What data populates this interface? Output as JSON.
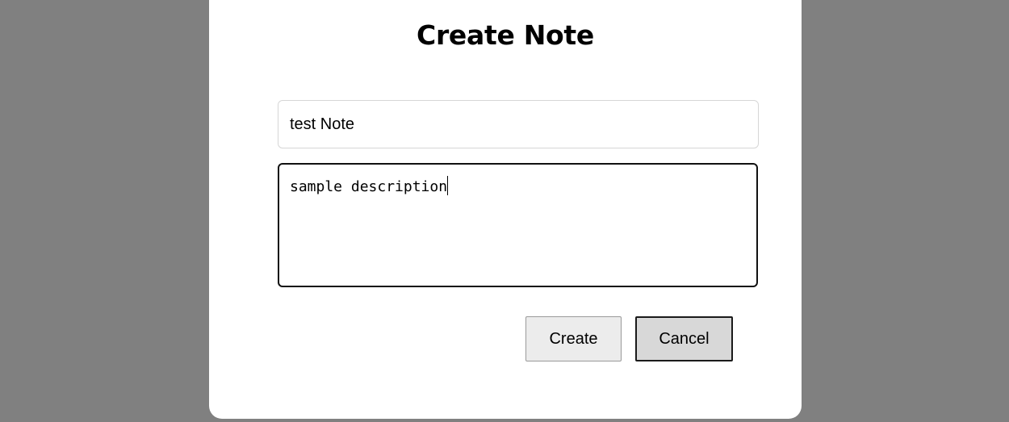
{
  "dialog": {
    "title": "Create Note",
    "title_input": {
      "value": "test Note"
    },
    "description_input": {
      "value": "sample description"
    },
    "buttons": {
      "create_label": "Create",
      "cancel_label": "Cancel"
    }
  },
  "colors": {
    "overlay": "#808080",
    "dialog_background": "#ffffff",
    "create_button": "#ececec",
    "cancel_button": "#d8d8d8"
  }
}
